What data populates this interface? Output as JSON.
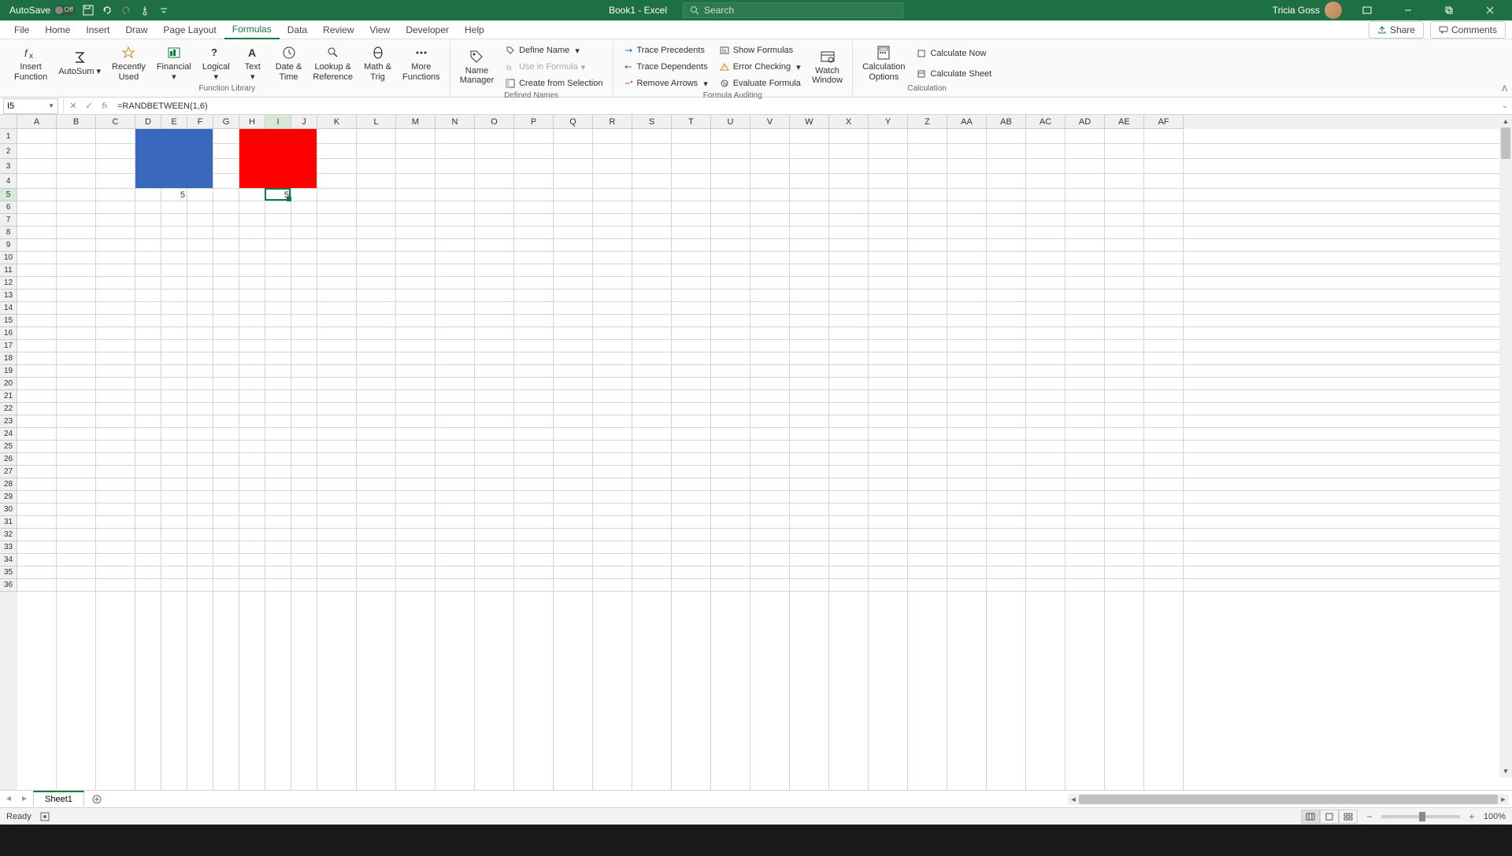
{
  "title_bar": {
    "autosave_label": "AutoSave",
    "autosave_state": "Off",
    "doc_title": "Book1  -  Excel",
    "search_placeholder": "Search",
    "user_name": "Tricia Goss"
  },
  "tabs": {
    "file": "File",
    "home": "Home",
    "insert": "Insert",
    "draw": "Draw",
    "page_layout": "Page Layout",
    "formulas": "Formulas",
    "data": "Data",
    "review": "Review",
    "view": "View",
    "developer": "Developer",
    "help": "Help",
    "share": "Share",
    "comments": "Comments",
    "active": "formulas"
  },
  "ribbon": {
    "groups": {
      "function_library": {
        "label": "Function Library",
        "insert_function": "Insert\nFunction",
        "autosum": "AutoSum",
        "recently_used": "Recently\nUsed",
        "financial": "Financial",
        "logical": "Logical",
        "text": "Text",
        "date_time": "Date &\nTime",
        "lookup_reference": "Lookup &\nReference",
        "math_trig": "Math &\nTrig",
        "more_functions": "More\nFunctions"
      },
      "defined_names": {
        "label": "Defined Names",
        "name_manager": "Name\nManager",
        "define_name": "Define Name",
        "use_in_formula": "Use in Formula",
        "create_from_selection": "Create from Selection"
      },
      "formula_auditing": {
        "label": "Formula Auditing",
        "trace_precedents": "Trace Precedents",
        "trace_dependents": "Trace Dependents",
        "remove_arrows": "Remove Arrows",
        "show_formulas": "Show Formulas",
        "error_checking": "Error Checking",
        "evaluate_formula": "Evaluate Formula",
        "watch_window": "Watch\nWindow"
      },
      "calculation": {
        "label": "Calculation",
        "calculation_options": "Calculation\nOptions",
        "calculate_now": "Calculate Now",
        "calculate_sheet": "Calculate Sheet"
      }
    }
  },
  "formula_bar": {
    "name_box": "I5",
    "formula": "=RANDBETWEEN(1,6)"
  },
  "grid": {
    "columns": [
      "A",
      "B",
      "C",
      "D",
      "E",
      "F",
      "G",
      "H",
      "I",
      "J",
      "K",
      "L",
      "M",
      "N",
      "O",
      "P",
      "Q",
      "R",
      "S",
      "T",
      "U",
      "V",
      "W",
      "X",
      "Y",
      "Z",
      "AA",
      "AB",
      "AC",
      "AD",
      "AE",
      "AF"
    ],
    "row_count": 36,
    "active_cell": "I5",
    "active_col": "I",
    "active_row": 5,
    "fills": [
      {
        "range": "D1:F4",
        "color": "blue"
      },
      {
        "range": "H1:J4",
        "color": "red"
      }
    ],
    "values": [
      {
        "cell": "E5",
        "value": "5"
      },
      {
        "cell": "I5",
        "value": "5"
      }
    ]
  },
  "sheet_bar": {
    "active_sheet": "Sheet1"
  },
  "status_bar": {
    "ready": "Ready",
    "zoom": "100%"
  }
}
